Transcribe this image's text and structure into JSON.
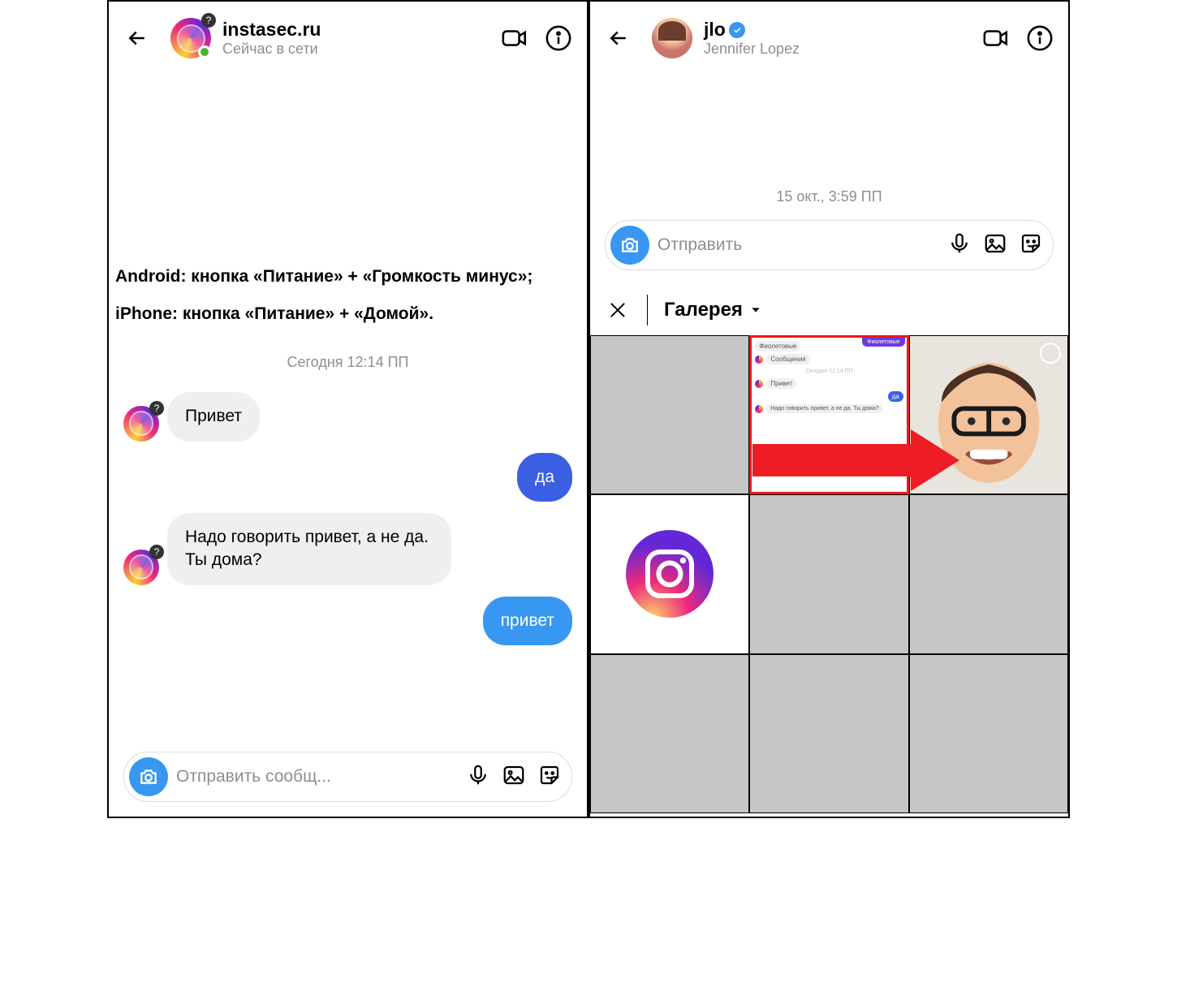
{
  "left": {
    "header": {
      "title": "instasec.ru",
      "sub": "Сейчас в сети"
    },
    "caption_line1": "Android: кнопка «Питание» + «Громкость минус»;",
    "caption_line2": "iPhone: кнопка «Питание» + «Домой».",
    "timestamp": "Сегодня 12:14 ПП",
    "messages": {
      "m1": "Привет",
      "m2": "да",
      "m3": "Надо говорить привет, а не да. Ты дома?",
      "m4": "привет"
    },
    "composer": {
      "placeholder": "Отправить сообщ..."
    }
  },
  "right": {
    "header": {
      "title": "jlo",
      "sub": "Jennifer Lopez"
    },
    "timestamp": "15 окт., 3:59 ПП",
    "composer": {
      "placeholder": "Отправить"
    },
    "gallery_title": "Галерея",
    "thumb": {
      "tag": "Фиолетовые",
      "t1": "Фиолетовые",
      "t2": "Сообщения",
      "ts": "Сегодня 12:14 ПП",
      "t3": "Привет",
      "t4": "да",
      "t5": "Надо говорить привет, а не да. Ты дома?"
    }
  }
}
